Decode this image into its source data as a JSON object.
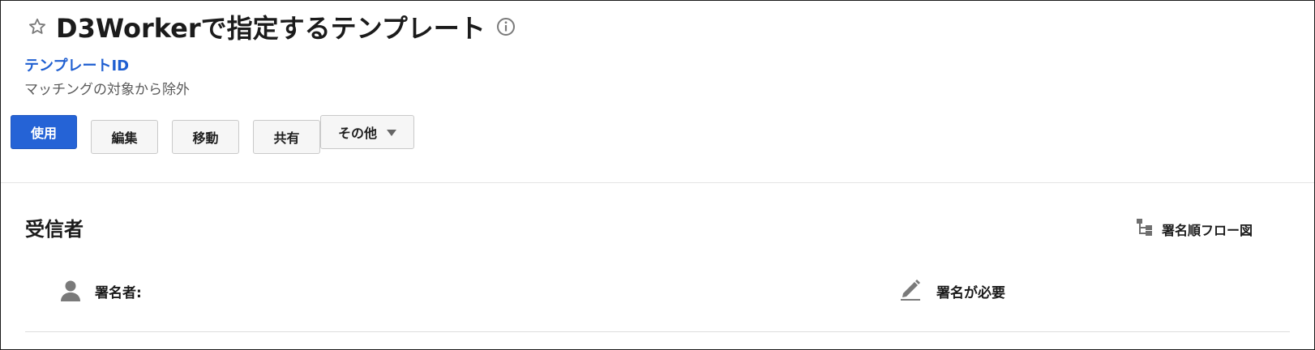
{
  "header": {
    "title": "D3Workerで指定するテンプレート",
    "template_id_label": "テンプレートID",
    "template_desc": "マッチングの対象から除外",
    "favorite_icon": "star-outline-icon",
    "info_icon": "info-circle-icon"
  },
  "toolbar": {
    "use_label": "使用",
    "edit_label": "編集",
    "move_label": "移動",
    "share_label": "共有",
    "more_label": "その他"
  },
  "recipients": {
    "section_title": "受信者",
    "flow_label": "署名順フロー図",
    "flow_icon": "hierarchy-tree-icon",
    "items": [
      {
        "role_label": "署名者:",
        "role_icon": "person-icon",
        "action_label": "署名が必要",
        "action_icon": "pen-icon"
      }
    ]
  },
  "colors": {
    "primary": "#2563d6",
    "link": "#1f5fd1",
    "icon_gray": "#7a7a7a",
    "text": "#1b1b1b"
  }
}
